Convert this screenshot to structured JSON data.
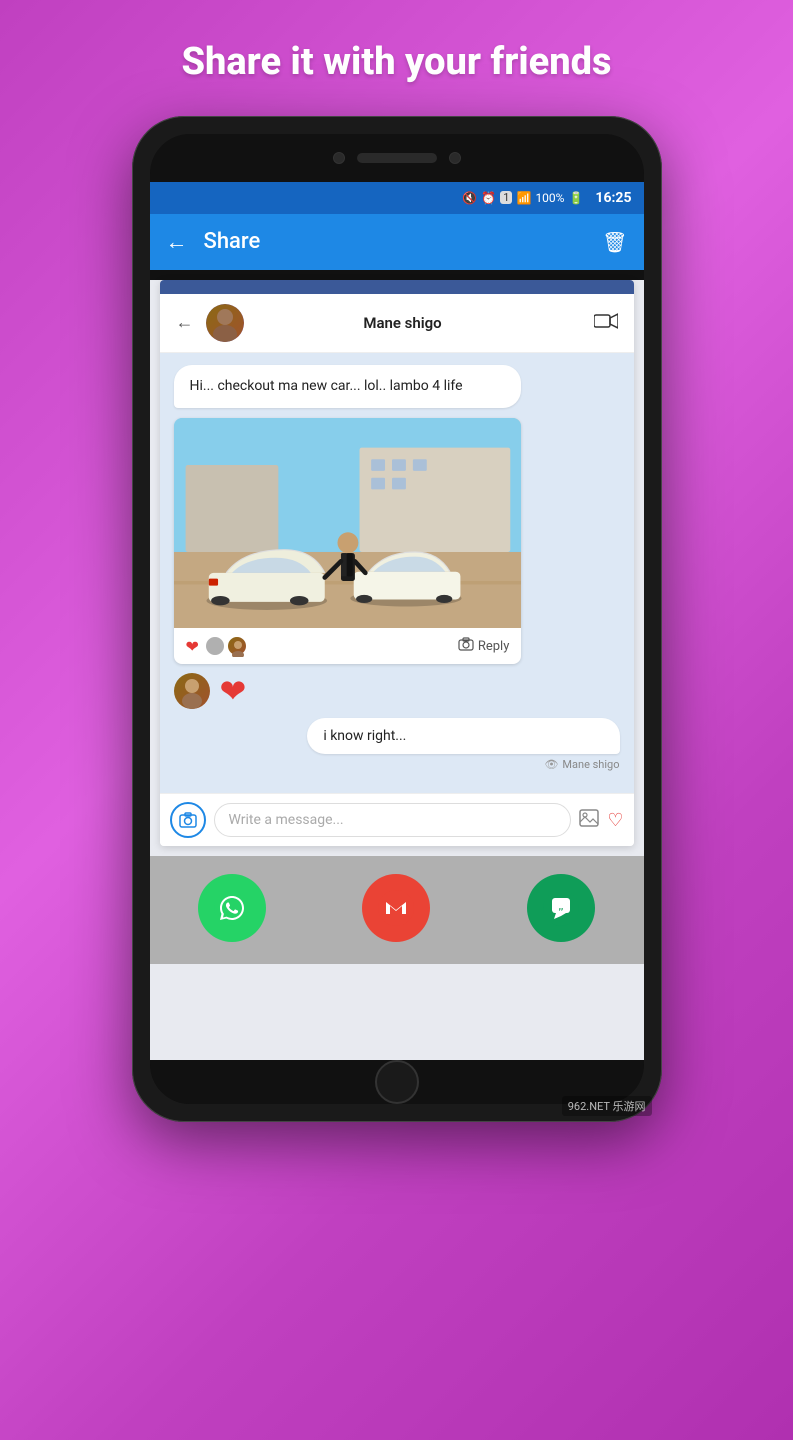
{
  "page": {
    "background_gradient": "linear-gradient(135deg, #c040c0, #e060e0)",
    "title": "Share it with your friends"
  },
  "phone": {
    "status_bar": {
      "mute_icon": "🔇",
      "alarm_icon": "⏰",
      "notification_icon": "1",
      "signal_icon": "📶",
      "battery": "100%",
      "time": "16:25"
    },
    "app_bar": {
      "back_label": "←",
      "title": "Share",
      "delete_label": "🗑"
    }
  },
  "chat": {
    "header": {
      "back_label": "←",
      "user_name": "Mane shigo",
      "video_icon": "📹"
    },
    "messages": [
      {
        "type": "text_bubble_other",
        "text": "Hi... checkout ma new car... lol.. lambo 4 life"
      },
      {
        "type": "post_image",
        "alt": "Cars photo with person"
      },
      {
        "type": "post_actions",
        "reply_label": "Reply"
      },
      {
        "type": "reaction_row",
        "heart": "❤"
      },
      {
        "type": "text_bubble_me",
        "text": "i know right..."
      },
      {
        "type": "seen",
        "seen_by": "Mane shigo"
      }
    ],
    "input": {
      "placeholder": "Write a message...",
      "camera_icon": "📷",
      "image_icon": "🖼",
      "heart_icon": "♡"
    }
  },
  "share_bar": {
    "apps": [
      {
        "name": "WhatsApp",
        "icon": "📞",
        "color": "#25d366"
      },
      {
        "name": "Gmail",
        "icon": "✉",
        "color": "#ea4335"
      },
      {
        "name": "Hangouts",
        "icon": "💬",
        "color": "#0f9d58"
      }
    ]
  },
  "watermark": {
    "text": "962.NET",
    "sub": "乐游网"
  }
}
